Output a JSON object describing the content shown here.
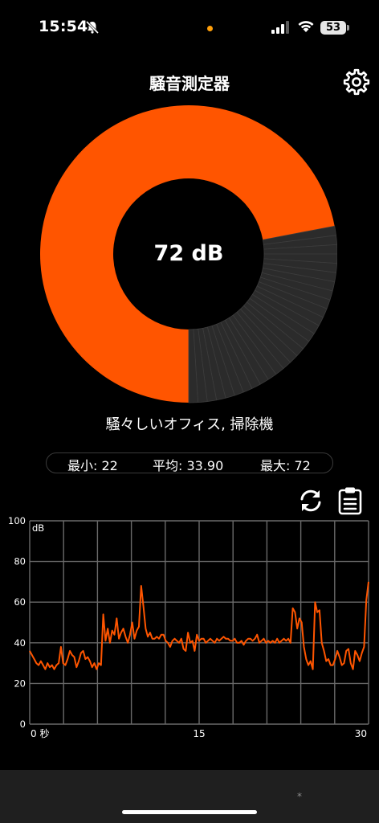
{
  "status_bar": {
    "time": "15:54",
    "battery": "53"
  },
  "header": {
    "title": "騒音測定器"
  },
  "gauge": {
    "value_text": "72 dB",
    "fill_fraction": 0.72,
    "total_segments": 100,
    "fill_color": "#ff5500",
    "empty_color": "#2b2b2b"
  },
  "description": "騒々しいオフィス, 掃除機",
  "stats": {
    "min": "最小: 22",
    "avg": "平均: 33.90",
    "max": "最大: 72"
  },
  "icons": {
    "settings": "gear-icon",
    "refresh": "refresh-icon",
    "clipboard": "clipboard-icon"
  },
  "chart_data": {
    "type": "line",
    "unit": "dB",
    "ylim": [
      0,
      100
    ],
    "xlim": [
      0,
      30
    ],
    "y_ticks": [
      "0",
      "20",
      "40",
      "60",
      "80",
      "100"
    ],
    "x_ticks": [
      {
        "value": 0,
        "label": "0 秒"
      },
      {
        "value": 15,
        "label": "15"
      },
      {
        "value": 30,
        "label": "30"
      }
    ],
    "grid": true,
    "line_color": "#ff5500",
    "series": [
      {
        "values": [
          36,
          34,
          32,
          30,
          29,
          31,
          29,
          27,
          30,
          28,
          29,
          27,
          29,
          30,
          38,
          30,
          29,
          32,
          36,
          34,
          33,
          28,
          31,
          35,
          36,
          32,
          33,
          31,
          28,
          30,
          27,
          30,
          29,
          54,
          41,
          47,
          40,
          46,
          44,
          52,
          42,
          45,
          47,
          43,
          40,
          44,
          50,
          42,
          46,
          48,
          68,
          58,
          47,
          43,
          45,
          42,
          42,
          43,
          42,
          44,
          44,
          41,
          40,
          38,
          41,
          42,
          41,
          40,
          42,
          37,
          36,
          45,
          40,
          41,
          36,
          44,
          41,
          42,
          42,
          40,
          41,
          42,
          41,
          40,
          42,
          41,
          42,
          43,
          42,
          42,
          41,
          41,
          42,
          40,
          40,
          41,
          39,
          41,
          42,
          42,
          41,
          42,
          44,
          40,
          41,
          42,
          40,
          41,
          40,
          41,
          40,
          42,
          40,
          41,
          42,
          41,
          42,
          40,
          57,
          55,
          47,
          52,
          50,
          38,
          32,
          29,
          31,
          27,
          60,
          55,
          56,
          40,
          36,
          31,
          32,
          29,
          29,
          32,
          36,
          33,
          29,
          30,
          36,
          37,
          30,
          27,
          36,
          34,
          31,
          35,
          38,
          61,
          70
        ]
      }
    ]
  }
}
